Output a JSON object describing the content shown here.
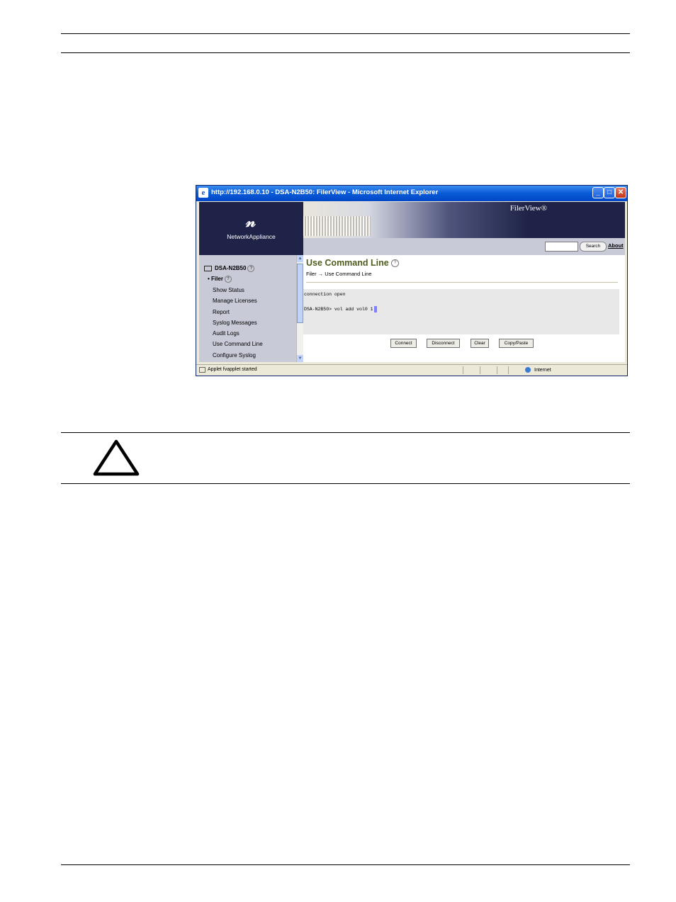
{
  "window": {
    "title": "http://192.168.0.10 - DSA-N2B50: FilerView - Microsoft Internet Explorer",
    "minimize": "_",
    "maximize": "□",
    "close": "✕"
  },
  "header": {
    "brand": "NetworkAppliance",
    "product": "FilerView®",
    "search_button": "Search",
    "about_link": "About"
  },
  "sidebar": {
    "host": "DSA-N2B50",
    "filer": "Filer",
    "items": [
      "Show Status",
      "Manage Licenses",
      "Report",
      "Syslog Messages",
      "Audit Logs",
      "Use Command Line",
      "Configure Syslog"
    ]
  },
  "main": {
    "title": "Use Command Line",
    "breadcrumb": "Filer → Use Command Line",
    "console_line1": "connection open",
    "console_line2": "DSA-N2B50> vol add vol0 1",
    "buttons": [
      "Connect",
      "Disconnect",
      "Clear",
      "Copy/Paste"
    ]
  },
  "statusbar": {
    "text": "Applet fvapplet started",
    "zone": "Internet"
  },
  "icons": {
    "caution": "caution-triangle-icon",
    "help": "help-icon",
    "ie": "ie-icon"
  },
  "colors": {
    "title_bar": "#0a5ad6",
    "page_title": "#4d5e1e",
    "nav_bg": "#c9cad8",
    "header_bg": "#1f2347"
  }
}
